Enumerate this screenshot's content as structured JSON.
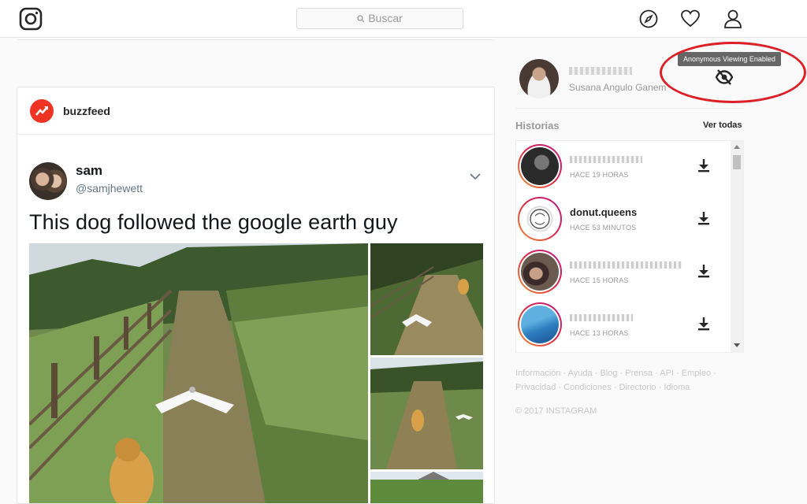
{
  "header": {
    "search_placeholder": "Buscar",
    "icons": [
      "instagram-logo",
      "search-icon",
      "compass-icon",
      "heart-icon",
      "user-icon"
    ]
  },
  "post": {
    "author": "buzzfeed",
    "tweet": {
      "name": "sam",
      "handle": "@samjhewett",
      "text": "This dog followed the google earth guy"
    }
  },
  "sidebar": {
    "user_fullname": "Susana Angulo Ganem",
    "tooltip": "Anonymous Viewing Enabled",
    "stories_label": "Historias",
    "see_all": "Ver todas",
    "stories": [
      {
        "name": "",
        "time": "HACE 19 HORAS"
      },
      {
        "name": "donut.queens",
        "time": "HACE 53 MINUTOS"
      },
      {
        "name": "",
        "time": "HACE 15 HORAS"
      },
      {
        "name": "",
        "time": "HACE 13 HORAS"
      }
    ],
    "footer_links": [
      "Información",
      "Ayuda",
      "Blog",
      "Prensa",
      "API",
      "Empleo",
      "Privacidad",
      "Condiciones",
      "Directorio",
      "Idioma"
    ],
    "copyright": "© 2017 INSTAGRAM"
  },
  "colors": {
    "highlight_ring": "#dd1f26",
    "buzzfeed_red": "#ee3322"
  }
}
